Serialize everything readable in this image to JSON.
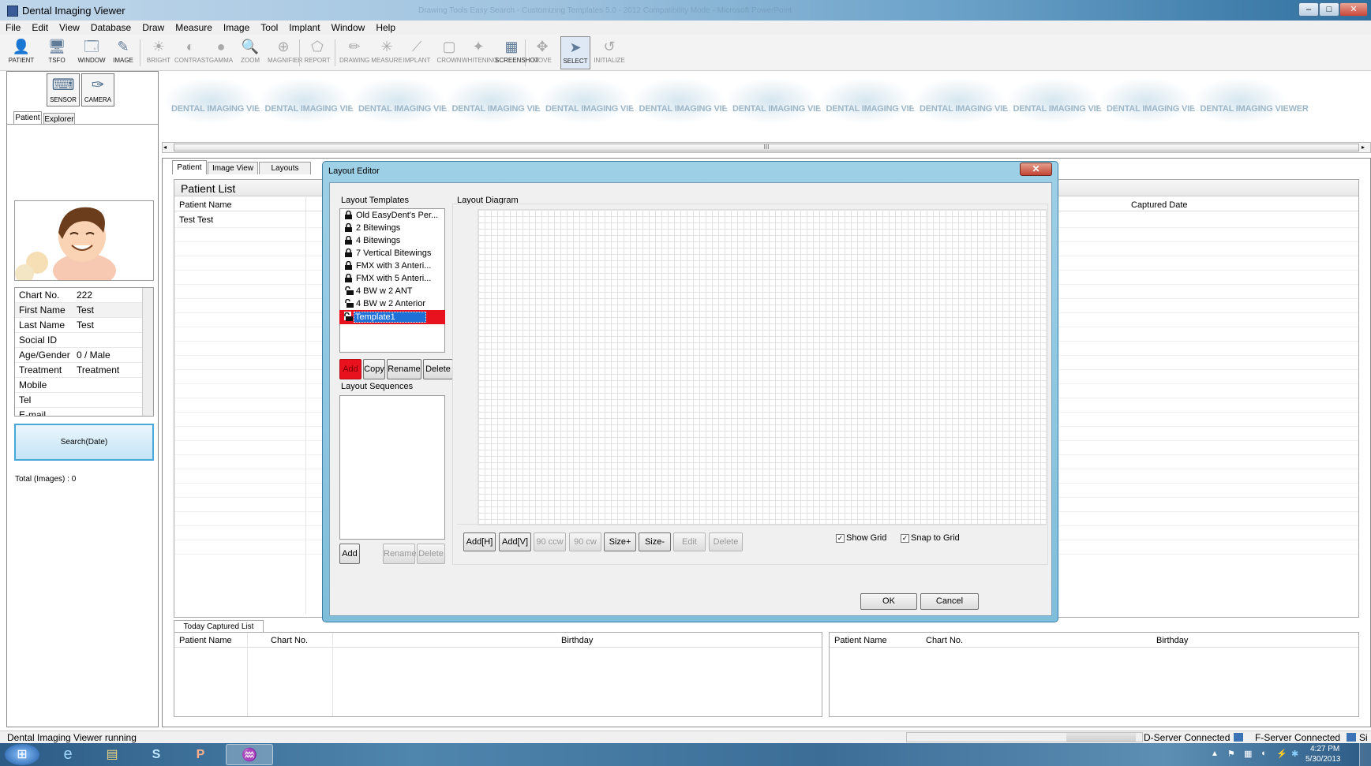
{
  "window": {
    "title": "Dental Imaging Viewer",
    "title_faded": "Drawing Tools     Easy Search - Customizing Templates 5.0 - 2012 Compatibility Mode - Microsoft PowerPoint",
    "min": "–",
    "max": "□",
    "close": "✕"
  },
  "menu": [
    "File",
    "Edit",
    "View",
    "Database",
    "Draw",
    "Measure",
    "Image",
    "Tool",
    "Implant",
    "Window",
    "Help"
  ],
  "toolbar": [
    {
      "label": "PATIENT",
      "icon": "patient-icon",
      "glyph": "👤"
    },
    {
      "label": "TSFO",
      "icon": "tsfo-icon",
      "glyph": "🖥"
    },
    {
      "label": "WINDOW",
      "icon": "window-icon",
      "glyph": "🗔"
    },
    {
      "label": "IMAGE",
      "icon": "image-icon",
      "glyph": "✎"
    },
    {
      "label": "BRIGHT",
      "icon": "bright-icon",
      "glyph": "☀"
    },
    {
      "label": "CONTRAST",
      "icon": "contrast-icon",
      "glyph": "◐"
    },
    {
      "label": "GAMMA",
      "icon": "gamma-icon",
      "glyph": "●"
    },
    {
      "label": "ZOOM",
      "icon": "zoom-icon",
      "glyph": "🔍"
    },
    {
      "label": "MAGNIFIER",
      "icon": "magnifier-icon",
      "glyph": "⊕"
    },
    {
      "label": "REPORT",
      "icon": "report-icon",
      "glyph": "⬠"
    },
    {
      "label": "DRAWING",
      "icon": "drawing-icon",
      "glyph": "✏"
    },
    {
      "label": "MEASURE",
      "icon": "measure-icon",
      "glyph": "✳"
    },
    {
      "label": "IMPLANT",
      "icon": "implant-icon",
      "glyph": "⟋"
    },
    {
      "label": "CROWN",
      "icon": "crown-icon",
      "glyph": "▢"
    },
    {
      "label": "WHITENING",
      "icon": "whitening-icon",
      "glyph": "✦"
    },
    {
      "label": "SCREENSHOT",
      "icon": "screenshot-icon",
      "glyph": "▦"
    },
    {
      "label": "MOVE",
      "icon": "move-icon",
      "glyph": "✥"
    },
    {
      "label": "SELECT",
      "icon": "select-icon",
      "glyph": "➤"
    },
    {
      "label": "INITIALIZE",
      "icon": "initialize-icon",
      "glyph": "↺"
    }
  ],
  "left": {
    "sensor": "SENSOR",
    "camera": "CAMERA",
    "tabs": [
      "Patient",
      "Explorer"
    ],
    "info": [
      {
        "k": "Chart No.",
        "v": "222"
      },
      {
        "k": "First Name",
        "v": "Test"
      },
      {
        "k": "Last Name",
        "v": "Test"
      },
      {
        "k": "Social ID",
        "v": ""
      },
      {
        "k": "Age/Gender",
        "v": "0 / Male"
      },
      {
        "k": "Treatment",
        "v": "Treatment"
      },
      {
        "k": "Mobile",
        "v": ""
      },
      {
        "k": "Tel",
        "v": ""
      },
      {
        "k": "E-mail",
        "v": ""
      }
    ],
    "search": "Search(Date)",
    "total": "Total (Images) : 0"
  },
  "banner_text": "DENTAL IMAGING VIEWER",
  "scroll_grip": "III",
  "main": {
    "tabs": [
      "Patient",
      "Image View",
      "Layouts"
    ],
    "patient_list_title": "Patient List",
    "col_name": "Patient Name",
    "col_captured": "Captured Date",
    "row1": "Test Test",
    "today_tab": "Today Captured List",
    "today_cols": [
      "Patient Name",
      "Chart No.",
      "Birthday"
    ],
    "today2_cols": [
      "Patient Name",
      "Chart No.",
      "Birthday"
    ]
  },
  "dialog": {
    "title": "Layout Editor",
    "close": "✕",
    "templates_label": "Layout Templates",
    "templates": [
      {
        "name": "Old EasyDent's Per...",
        "locked": true
      },
      {
        "name": "2 Bitewings",
        "locked": true
      },
      {
        "name": "4 Bitewings",
        "locked": true
      },
      {
        "name": "7 Vertical Bitewings",
        "locked": true
      },
      {
        "name": "FMX with 3 Anteri...",
        "locked": true
      },
      {
        "name": "FMX with 5 Anteri...",
        "locked": true
      },
      {
        "name": "4 BW w 2 ANT",
        "locked": false
      },
      {
        "name": "4 BW w 2 Anterior",
        "locked": false
      },
      {
        "name": "Template1",
        "locked": false,
        "selected": true
      }
    ],
    "tpl_buttons": [
      "Add",
      "Copy",
      "Rename",
      "Delete"
    ],
    "sequences_label": "Layout Sequences",
    "seq_buttons": [
      "Add",
      "Rename",
      "Delete"
    ],
    "diagram_label": "Layout Diagram",
    "diagram_buttons": [
      "Add[H]",
      "Add[V]",
      "90 ccw",
      "90 cw",
      "Size+",
      "Size-",
      "Edit",
      "Delete"
    ],
    "show_grid": "Show Grid",
    "snap_grid": "Snap to Grid",
    "ok": "OK",
    "cancel": "Cancel",
    "highlight_color": "#e8121f"
  },
  "status": {
    "left": "Dental Imaging Viewer running",
    "dserver": "D-Server Connected",
    "fserver": "F-Server Connected",
    "si": "Si"
  },
  "taskbar": {
    "time": "4:27 PM",
    "date": "5/30/2013",
    "apps": [
      "start-orb",
      "internet-explorer",
      "file-explorer",
      "skype",
      "powerpoint",
      "dental-imaging-viewer"
    ]
  }
}
